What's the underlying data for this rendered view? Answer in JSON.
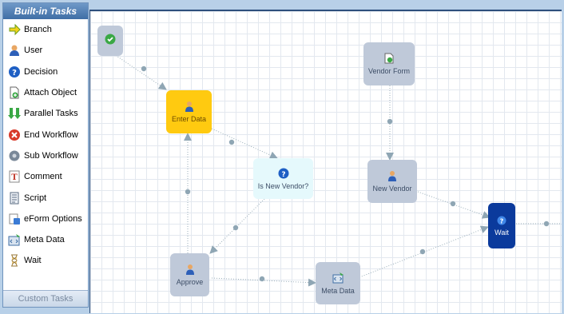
{
  "palette": {
    "title": "Built-in Tasks",
    "items": [
      {
        "label": "Branch",
        "icon": "branch-arrow-icon"
      },
      {
        "label": "User",
        "icon": "user-icon"
      },
      {
        "label": "Decision",
        "icon": "question-icon"
      },
      {
        "label": "Attach Object",
        "icon": "attach-object-icon"
      },
      {
        "label": "Parallel Tasks",
        "icon": "parallel-tasks-icon"
      },
      {
        "label": "End Workflow",
        "icon": "end-workflow-icon"
      },
      {
        "label": "Sub Workflow",
        "icon": "sub-workflow-icon"
      },
      {
        "label": "Comment",
        "icon": "comment-icon"
      },
      {
        "label": "Script",
        "icon": "script-icon"
      },
      {
        "label": "eForm Options",
        "icon": "eform-options-icon"
      },
      {
        "label": "Meta Data",
        "icon": "meta-data-icon"
      },
      {
        "label": "Wait",
        "icon": "hourglass-icon"
      }
    ],
    "footer": "Custom Tasks"
  },
  "canvas": {
    "nodes": {
      "start": {
        "label": ""
      },
      "enter_data": {
        "label": "Enter Data"
      },
      "vendor_form": {
        "label": "Vendor Form"
      },
      "is_new_vendor": {
        "label": "Is New Vendor?"
      },
      "new_vendor": {
        "label": "New Vendor"
      },
      "approve": {
        "label": "Approve"
      },
      "meta_data": {
        "label": "Meta Data"
      },
      "wait": {
        "label": "Wait"
      }
    }
  },
  "colors": {
    "enter_data_fill": "#ffca10",
    "wait_fill": "#0b3a9c",
    "decision_fill": "#e5f9fc",
    "task_fill": "#bfc9d9",
    "connector": "#8fa6b4"
  }
}
